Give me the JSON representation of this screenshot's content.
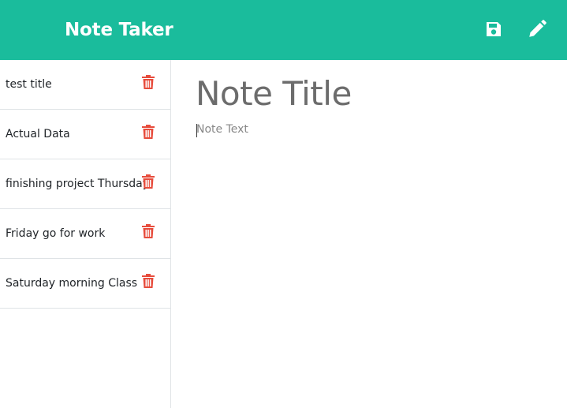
{
  "app": {
    "title": "Note Taker",
    "accent_color": "#1abc9c",
    "delete_color": "#e74c3c"
  },
  "toolbar": {
    "save_icon": "save-icon",
    "new_note_icon": "pencil-icon"
  },
  "notes": [
    {
      "title": "test title"
    },
    {
      "title": "Actual Data"
    },
    {
      "title": "finishing project Thursday"
    },
    {
      "title": "Friday go for work"
    },
    {
      "title": "Saturday morning Class"
    }
  ],
  "editor": {
    "title_placeholder": "Note Title",
    "text_placeholder": "Note Text"
  }
}
